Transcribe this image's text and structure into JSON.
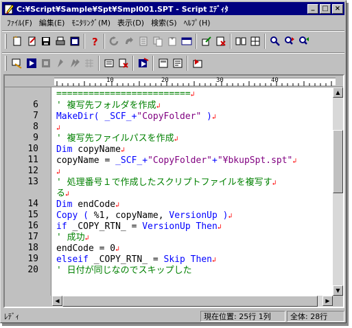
{
  "window": {
    "title": "C:¥Script¥Sample¥Spt¥Smpl001.SPT - Script ｴﾃﾞｨﾀ",
    "minimize": "_",
    "maximize": "□",
    "close": "×"
  },
  "menu": [
    {
      "label": "ﾌｧｲﾙ(F)"
    },
    {
      "label": "編集(E)"
    },
    {
      "label": "ﾓﾆﾀﾘﾝｸﾞ(M)"
    },
    {
      "label": "表示(D)"
    },
    {
      "label": "検索(S)"
    },
    {
      "label": "ﾍﾙﾌﾟ(H)"
    }
  ],
  "toolbar1": [
    "new-script-icon",
    "open-script-icon",
    "save-icon",
    "print-icon",
    "properties-icon",
    "help-icon",
    "run-icon",
    "step-icon",
    "list-icon",
    "copy-icon",
    "insert-icon",
    "window-icon",
    "check-icon",
    "debug-icon",
    "compare-icon",
    "tile-icon",
    "find-icon",
    "find-next-icon",
    "find-prev-icon"
  ],
  "toolbar2": [
    "monitor-icon",
    "start-icon",
    "stop-icon",
    "watch-icon",
    "watch-all-icon",
    "grid-icon",
    "record-icon",
    "clear-icon",
    "send-icon",
    "window1-icon",
    "window2-icon",
    "exec-icon"
  ],
  "ruler": {
    "marks": [
      "10",
      "20",
      "30",
      "40"
    ]
  },
  "editor": {
    "first_line_text": "=========================",
    "lines": [
      {
        "num": "6",
        "segments": [
          {
            "cls": "c-comment",
            "text": "' 複写先フォルダを作成"
          }
        ]
      },
      {
        "num": "7",
        "segments": [
          {
            "cls": "c-blue",
            "text": "MakeDir( _SCF_+"
          },
          {
            "cls": "c-string",
            "text": "\"CopyFolder\""
          },
          {
            "cls": "c-blue",
            "text": " )"
          }
        ]
      },
      {
        "num": "8",
        "segments": []
      },
      {
        "num": "9",
        "segments": [
          {
            "cls": "c-comment",
            "text": "' 複写先ファイルパスを作成"
          }
        ]
      },
      {
        "num": "10",
        "segments": [
          {
            "cls": "c-keyword",
            "text": "Dim"
          },
          {
            "cls": "c-text",
            "text": " copyName"
          }
        ]
      },
      {
        "num": "11",
        "segments": [
          {
            "cls": "c-text",
            "text": "copyName = "
          },
          {
            "cls": "c-blue",
            "text": "_SCF_+"
          },
          {
            "cls": "c-string",
            "text": "\"CopyFolder\""
          },
          {
            "cls": "c-blue",
            "text": "+"
          },
          {
            "cls": "c-string",
            "text": "\"¥bkupSpt.spt\""
          }
        ]
      },
      {
        "num": "12",
        "segments": []
      },
      {
        "num": "13",
        "segments": [
          {
            "cls": "c-comment",
            "text": "' 処理番号１で作成したスクリプトファイルを複写す"
          }
        ]
      },
      {
        "num": "",
        "segments": [
          {
            "cls": "c-comment",
            "text": "る"
          }
        ]
      },
      {
        "num": "14",
        "segments": [
          {
            "cls": "c-keyword",
            "text": "Dim"
          },
          {
            "cls": "c-text",
            "text": " endCode"
          }
        ]
      },
      {
        "num": "15",
        "segments": [
          {
            "cls": "c-blue",
            "text": "Copy ( "
          },
          {
            "cls": "c-text",
            "text": "%1, copyName, "
          },
          {
            "cls": "c-blue",
            "text": "VersionUp )"
          }
        ]
      },
      {
        "num": "16",
        "segments": [
          {
            "cls": "c-keyword",
            "text": "if"
          },
          {
            "cls": "c-text",
            "text": " _COPY_RTN_ = "
          },
          {
            "cls": "c-blue",
            "text": "VersionUp Then"
          }
        ]
      },
      {
        "num": "17",
        "segments": [
          {
            "cls": "c-comment",
            "text": "    ' 成功"
          }
        ]
      },
      {
        "num": "18",
        "segments": [
          {
            "cls": "c-text",
            "text": "    endCode = 0"
          }
        ]
      },
      {
        "num": "19",
        "segments": [
          {
            "cls": "c-keyword",
            "text": "elseif"
          },
          {
            "cls": "c-text",
            "text": " _COPY_RTN_ = "
          },
          {
            "cls": "c-blue",
            "text": "Skip Then"
          }
        ]
      },
      {
        "num": "20",
        "segments": [
          {
            "cls": "c-comment",
            "text": "    ' 日付が同じなのでスキップした"
          }
        ]
      }
    ],
    "eol_mark": "↲"
  },
  "status": {
    "ready": "ﾚﾃﾞｨ",
    "position": "現在位置:   25行  1列",
    "total": "全体:   28行"
  }
}
